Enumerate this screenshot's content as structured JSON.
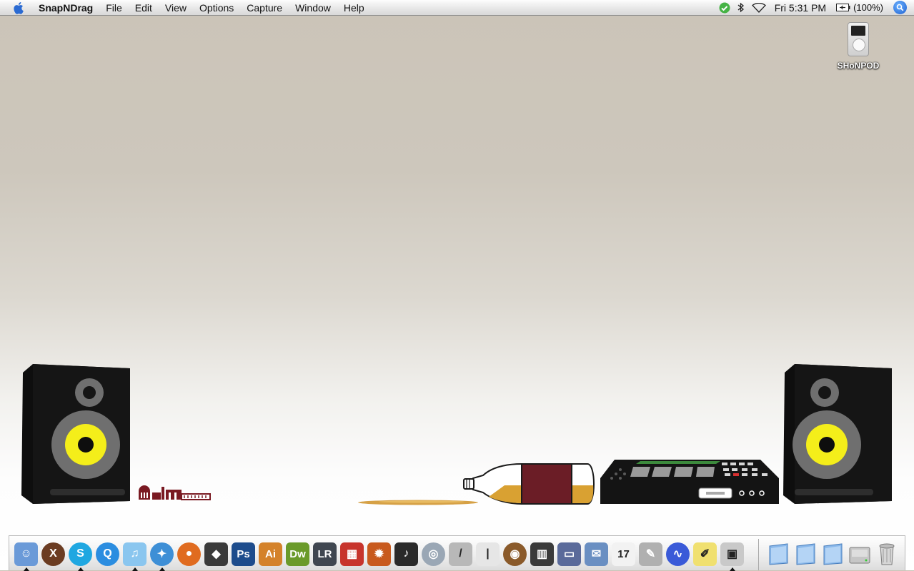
{
  "menubar": {
    "app_name": "SnapNDrag",
    "items": [
      "File",
      "Edit",
      "View",
      "Options",
      "Capture",
      "Window",
      "Help"
    ],
    "clock": "Fri 5:31 PM",
    "battery": "(100%)",
    "status_icons": [
      "growl-icon",
      "bluetooth-icon",
      "wifi-icon",
      "battery-icon",
      "spotlight-icon"
    ]
  },
  "desktop": {
    "drive_label": "SHoNPOD"
  },
  "dock": {
    "apps": [
      {
        "icon": "finder-icon",
        "bg": "#6a9ad8",
        "glyph": "☺",
        "running": true
      },
      {
        "icon": "crossover-icon",
        "bg": "#6b3c22",
        "glyph": "X",
        "running": false
      },
      {
        "icon": "skype-icon",
        "bg": "#1fa7e1",
        "glyph": "S",
        "running": true
      },
      {
        "icon": "quicktime-icon",
        "bg": "#2b8de0",
        "glyph": "Q",
        "running": false
      },
      {
        "icon": "itunes-icon",
        "bg": "#8ac6ef",
        "glyph": "♫",
        "running": true
      },
      {
        "icon": "safari-icon",
        "bg": "#3e8fd6",
        "glyph": "✦",
        "running": true
      },
      {
        "icon": "firefox-icon",
        "bg": "#e06b1f",
        "glyph": "●",
        "running": false
      },
      {
        "icon": "cyberduck-icon",
        "bg": "#3a3a3a",
        "glyph": "◆",
        "running": false
      },
      {
        "icon": "photoshop-icon",
        "bg": "#1d4c8c",
        "glyph": "Ps",
        "running": false
      },
      {
        "icon": "illustrator-icon",
        "bg": "#d4822a",
        "glyph": "Ai",
        "running": false
      },
      {
        "icon": "dreamweaver-icon",
        "bg": "#6a9a2a",
        "glyph": "Dw",
        "running": false
      },
      {
        "icon": "lightroom-icon",
        "bg": "#3f4650",
        "glyph": "LR",
        "running": false
      },
      {
        "icon": "photobooth-icon",
        "bg": "#c7342c",
        "glyph": "▦",
        "running": false
      },
      {
        "icon": "reason-icon",
        "bg": "#c85a1e",
        "glyph": "✹",
        "running": false
      },
      {
        "icon": "logic-icon",
        "bg": "#2a2a2a",
        "glyph": "♪",
        "running": false
      },
      {
        "icon": "audio-cd-icon",
        "bg": "#9aa7b5",
        "glyph": "◎",
        "running": false
      },
      {
        "icon": "guitar-icon",
        "bg": "#b8b8b8",
        "glyph": "/",
        "running": false
      },
      {
        "icon": "microphone-icon",
        "bg": "#e6e6e6",
        "glyph": "|",
        "running": false
      },
      {
        "icon": "record-icon",
        "bg": "#8a5a2a",
        "glyph": "◉",
        "running": false
      },
      {
        "icon": "piano-icon",
        "bg": "#3a3a3a",
        "glyph": "▥",
        "running": false
      },
      {
        "icon": "keyboard-icon",
        "bg": "#5a6a9a",
        "glyph": "▭",
        "running": false
      },
      {
        "icon": "mail-icon",
        "bg": "#6a8fc2",
        "glyph": "✉",
        "running": false
      },
      {
        "icon": "ical-icon",
        "bg": "#f2f2f2",
        "glyph": "17",
        "running": false
      },
      {
        "icon": "script-icon",
        "bg": "#b0b0b0",
        "glyph": "✎",
        "running": false
      },
      {
        "icon": "waveform-icon",
        "bg": "#3a5ad8",
        "glyph": "∿",
        "running": false
      },
      {
        "icon": "stickies-icon",
        "bg": "#f0e070",
        "glyph": "✐",
        "running": false
      },
      {
        "icon": "iphoto-icon",
        "bg": "#c9c9c9",
        "glyph": "▣",
        "running": true
      }
    ],
    "right": [
      {
        "icon": "folder-icon"
      },
      {
        "icon": "folder-icon"
      },
      {
        "icon": "folder-icon"
      },
      {
        "icon": "hard-drive-icon"
      },
      {
        "icon": "trash-icon"
      }
    ]
  }
}
